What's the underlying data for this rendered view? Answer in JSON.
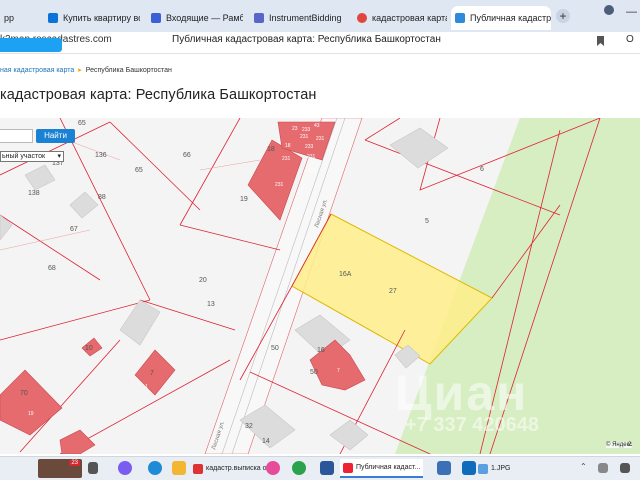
{
  "browser": {
    "tabs": [
      {
        "label": "рр",
        "color": "#2a7de1"
      },
      {
        "label": "Купить квартиру во вт",
        "color": "#0b72d9"
      },
      {
        "label": "Входящие — Рамблер/",
        "color": "#3c5fd6"
      },
      {
        "label": "InstrumentBidding",
        "color": "#5865c9"
      },
      {
        "label": "кадастровая карта по",
        "color": "#e2453c"
      },
      {
        "label": "Публичная кадастро",
        "color": "#2e8bd9",
        "active": true
      }
    ],
    "new_tab_glyph": "+",
    "url": "k3map.roscadastres.com",
    "page_title": "Публичная кадастровая карта: Республика Башкортостан",
    "min_glyph": "—",
    "profile_glyph": "О"
  },
  "page": {
    "breadcrumb": {
      "link": "ная кадастровая карта",
      "current": "Республика Башкортостан"
    },
    "heading": "кадастровая карта: Республика Башкортостан",
    "search": {
      "button": "Найти",
      "value": ""
    },
    "layer_select": {
      "selected": "ьный участок"
    }
  },
  "map": {
    "parcel_labels": [
      "65",
      "136",
      "66",
      "18",
      "6",
      "137",
      "138",
      "88",
      "65",
      "19",
      "5",
      "67",
      "68",
      "16А",
      "27",
      "20",
      "13",
      "50",
      "16",
      "50",
      "70",
      "32",
      "14",
      "10",
      "7"
    ],
    "road_labels": [
      "Лесная ул.",
      "Лесная ул."
    ],
    "building_numbers": [
      "233",
      "23",
      "43",
      "231",
      "231",
      "233",
      "18",
      "231",
      "10",
      "231",
      "231",
      "231",
      "7",
      "1",
      "19"
    ],
    "highlight_color": "#ffef8a",
    "forest_color": "#d6eec2",
    "building_color": "#e56b6f",
    "watermark_main": "Циан",
    "watermark_phone": "+7 337 420648",
    "attribution": "© Яндекс",
    "scale": "2"
  },
  "taskbar": {
    "thumb_badge": "23",
    "apps": [
      {
        "label": "кадастр.выписка о..."
      },
      {
        "label": "Публичная кадаст..."
      },
      {
        "label": "1.JPG"
      }
    ]
  }
}
